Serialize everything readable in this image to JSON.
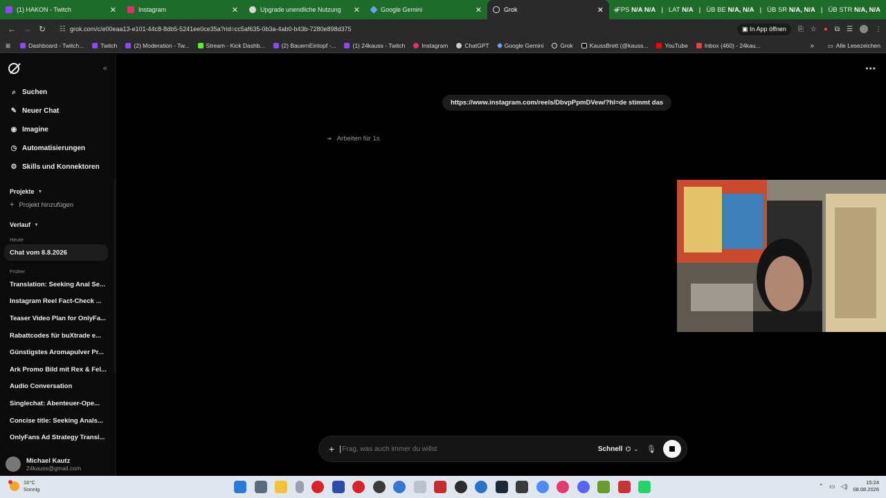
{
  "browser": {
    "tabs": [
      {
        "title": "(1) HAKON - Twitch",
        "fav_color": "#9146ff",
        "active": false
      },
      {
        "title": "Instagram",
        "fav_color": "#e1306c",
        "active": false
      },
      {
        "title": "Upgrade unendliche Nutzung",
        "fav_color": "#d8d8d8",
        "active": false
      },
      {
        "title": "Google Gemini",
        "fav_color": "#6aa3ff",
        "active": false
      },
      {
        "title": "Grok",
        "fav_color": "#e0e0e0",
        "active": true
      }
    ],
    "stats": [
      {
        "label": "FPS",
        "val1": "N/A",
        "val2": "N/A"
      },
      {
        "label": "LAT",
        "val1": "N/A",
        "val2": ""
      },
      {
        "label": "ÜB BE",
        "val1": "N/A,",
        "val2": "N/A"
      },
      {
        "label": "ÜB SR",
        "val1": "N/A,",
        "val2": "N/A"
      },
      {
        "label": "ÜB STR",
        "val1": "N/A,",
        "val2": "N/A"
      }
    ],
    "url": "grok.com/c/e00eaa13-e101-44c8-8db5-5241ee0ce35a?rid=cc5af635-0b3a-4ab0-b43b-7280e898d375",
    "open_in_app": "In App öffnen",
    "bookmarks": [
      {
        "label": "Dashboard - Twitch...",
        "color": "#9146ff"
      },
      {
        "label": "Twitch",
        "color": "#9146ff"
      },
      {
        "label": "(2) Moderation - Tw...",
        "color": "#9146ff"
      },
      {
        "label": "Stream - Kick Dashb...",
        "color": "#53fc18"
      },
      {
        "label": "(2) BauernEintopf -...",
        "color": "#9146ff"
      },
      {
        "label": "(1) 24kauss - Twitch",
        "color": "#9146ff"
      },
      {
        "label": "Instagram",
        "color": "#e1306c"
      },
      {
        "label": "ChatGPT",
        "color": "#cccccc"
      },
      {
        "label": "Google Gemini",
        "color": "#6aa3ff"
      },
      {
        "label": "Grok",
        "color": "#e0e0e0"
      },
      {
        "label": "KaussBrett (@kauss...",
        "color": "#111111"
      },
      {
        "label": "YouTube",
        "color": "#ff0000"
      },
      {
        "label": "Inbox (460) - 24kau...",
        "color": "#ea4335"
      }
    ],
    "all_bookmarks": "Alle Lesezeichen"
  },
  "sidebar": {
    "nav": [
      {
        "label": "Suchen",
        "icon": "search-icon",
        "glyph": "⌕"
      },
      {
        "label": "Neuer Chat",
        "icon": "edit-icon",
        "glyph": "✎"
      },
      {
        "label": "Imagine",
        "icon": "image-icon",
        "glyph": "◉"
      },
      {
        "label": "Automatisierungen",
        "icon": "clock-icon",
        "glyph": "◷"
      },
      {
        "label": "Skills und Konnektoren",
        "icon": "skills-icon",
        "glyph": "⚙"
      }
    ],
    "projects_label": "Projekte",
    "add_project": "Projekt hinzufügen",
    "history_label": "Verlauf",
    "today_label": "Heute",
    "today_items": [
      "Chat vom 8.8.2026"
    ],
    "earlier_label": "Früher",
    "earlier_items": [
      "Translation: Seeking Anal Se...",
      "Instagram Reel Fact-Check ...",
      "Teaser Video Plan for OnlyFa...",
      "Rabattcodes für buXtrade e...",
      "Günstigstes Aromapulver Pr...",
      "Ark Promo Bild mit Rex & Fel...",
      "Audio Conversation",
      "Singlechat: Abenteuer-Ope...",
      "Concise title: Seeking Anals...",
      "OnlyFans Ad Strategy Transl..."
    ],
    "user_name": "Michael Kautz",
    "user_email": "24kauss@gmail.com"
  },
  "main": {
    "user_message": "https://www.instagram.com/reels/DbvpPpmDVew/?hl=de stimmt das",
    "status": "Arbeiten für 1s",
    "composer_placeholder": "Frag, was auch immer du willst",
    "mode": "Schnell"
  },
  "taskbar": {
    "weather_temp": "16°C",
    "weather_desc": "Sonnig",
    "time": "15:24",
    "date": "08.08.2026"
  }
}
